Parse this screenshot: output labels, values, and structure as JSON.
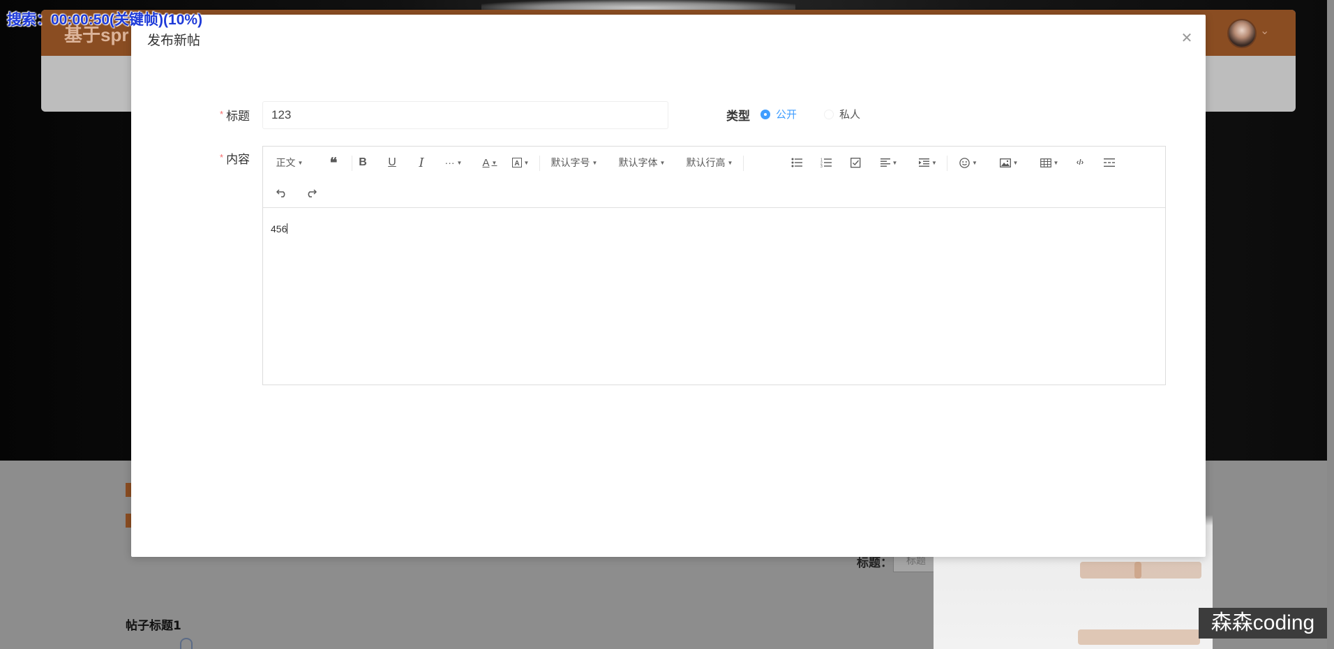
{
  "background": {
    "app_title": "基于spr",
    "title_label": "标题：",
    "title_input_placeholder": "标题",
    "post_title": "帖子标题1",
    "avatar_icon": "user-avatar",
    "chevron_icon": "chevron-down-icon"
  },
  "dialog": {
    "title": "发布新帖",
    "close_icon": "close-icon",
    "form": {
      "title_label": "标题",
      "title_value": "123",
      "required_mark": "*",
      "type_label": "类型",
      "type_options": [
        "公开",
        "私人"
      ],
      "type_selected": "公开",
      "content_label": "内容"
    },
    "editor": {
      "toolbar": {
        "paragraph": "正文",
        "font_size": "默认字号",
        "font_family": "默认字体",
        "line_height": "默认行高",
        "icons": [
          "quote-icon",
          "bold-icon",
          "underline-icon",
          "italic-icon",
          "more-icon",
          "font-color-icon",
          "background-color-icon",
          "bulleted-list-icon",
          "numbered-list-icon",
          "todo-icon",
          "align-icon",
          "indent-icon",
          "emoji-icon",
          "image-icon",
          "table-icon",
          "code-icon",
          "divider-icon",
          "undo-icon",
          "redo-icon"
        ]
      },
      "content": "456"
    }
  },
  "overlay": {
    "search_status": "搜索：00:00:50(关键帧)(10%)",
    "watermark": "森森coding"
  },
  "colors": {
    "primary": "#409eff",
    "brand": "#8a4d22",
    "required": "#f56c6c"
  }
}
